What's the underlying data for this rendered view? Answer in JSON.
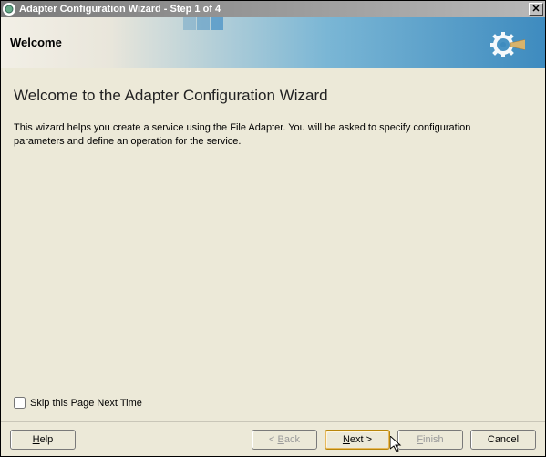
{
  "titlebar": {
    "title": "Adapter Configuration Wizard - Step 1 of 4",
    "close": "X"
  },
  "banner": {
    "welcome": "Welcome"
  },
  "main": {
    "heading": "Welcome to the Adapter Configuration Wizard",
    "body": "This wizard helps you create a service using the File Adapter. You will be asked to specify configuration parameters and define an operation for the service."
  },
  "skip": {
    "label": "Skip this Page Next Time",
    "checked": false
  },
  "buttons": {
    "help_pre": "H",
    "help_post": "elp",
    "back_pre": "< ",
    "back_u": "B",
    "back_post": "ack",
    "next_u": "N",
    "next_post": "ext >",
    "finish_u": "F",
    "finish_post": "inish",
    "cancel": "Cancel"
  }
}
